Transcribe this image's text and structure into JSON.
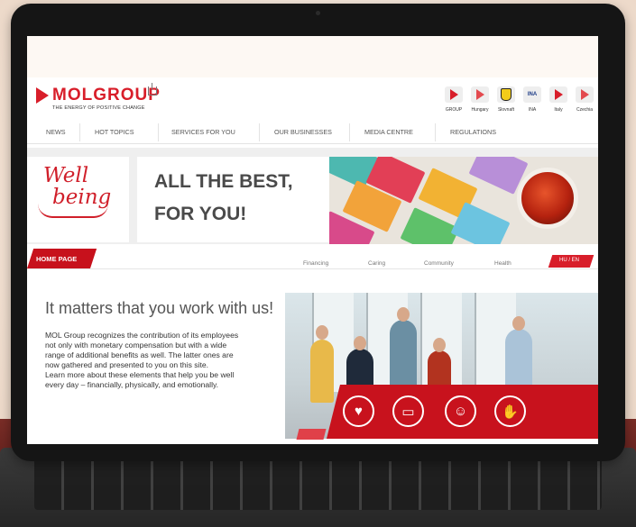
{
  "header": {
    "brand": "MOLGROUP",
    "tagline": "THE ENERGY OF POSITIVE CHANGE"
  },
  "countries": [
    {
      "label": "GROUP",
      "icon": "mol-triangle-icon"
    },
    {
      "label": "Hungary",
      "icon": "mol-hu-icon"
    },
    {
      "label": "Slovnaft",
      "icon": "slovnaft-shield-icon"
    },
    {
      "label": "INA",
      "icon": "ina-icon"
    },
    {
      "label": "Italy",
      "icon": "mol-triangle-icon"
    },
    {
      "label": "Czechia",
      "icon": "mol-cz-icon"
    }
  ],
  "nav": [
    "NEWS",
    "HOT TOPICS",
    "SERVICES FOR YOU",
    "OUR BUSINESSES",
    "MEDIA CENTRE",
    "REGULATIONS"
  ],
  "banner": {
    "wellbeing_line1": "Well",
    "wellbeing_line2": "being",
    "headline_line1": "ALL THE BEST,",
    "headline_line2": "FOR YOU!"
  },
  "subnav": {
    "home": "HOME PAGE",
    "items": [
      "Financing",
      "Caring",
      "Community",
      "Health"
    ],
    "lang": "HU / EN"
  },
  "main": {
    "title": "It matters that you work with us!",
    "lines": [
      "MOL Group recognizes the contribution of its employees",
      "not only with monetary compensation but with a wide",
      "range of additional benefits as well. The latter ones are",
      "now gathered and presented to you on this site.",
      "Learn more about these elements that help you be well",
      "every day – financially, physically, and emotionally."
    ]
  },
  "colors": {
    "brand_red": "#d81e2a",
    "text_gray": "#4a4a4a"
  }
}
